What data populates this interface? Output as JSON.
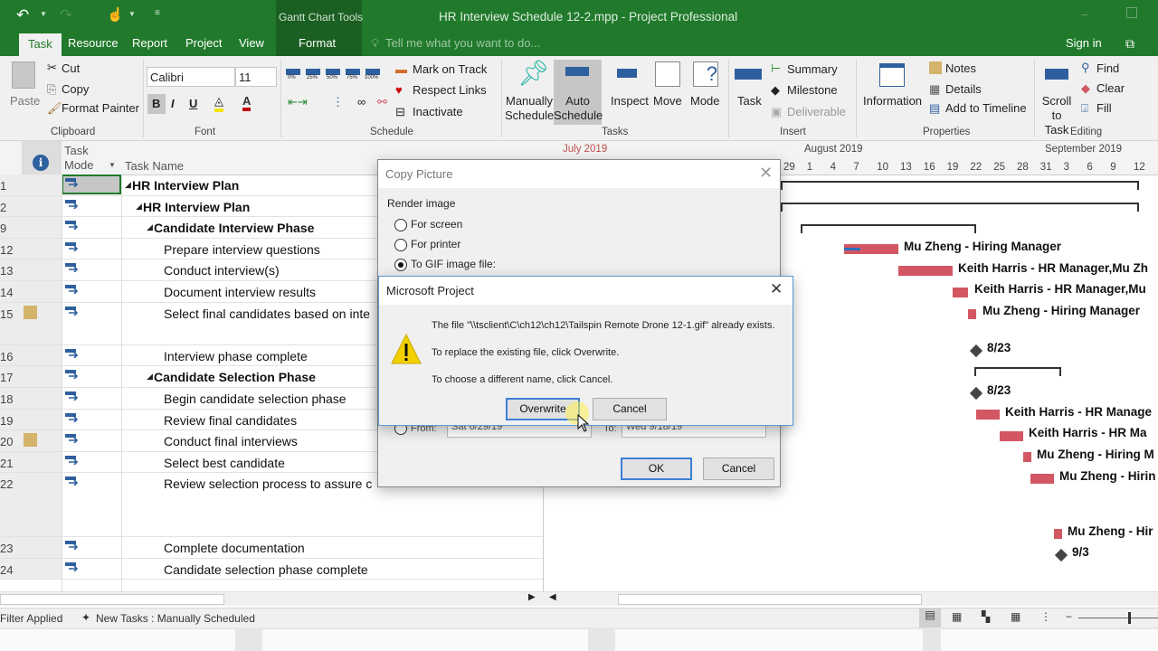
{
  "window": {
    "title": "HR Interview Schedule 12-2.mpp - Project Professional",
    "context_tab_group": "Gantt Chart Tools",
    "sign_in": "Sign in"
  },
  "tabs": [
    {
      "label": "Task",
      "active": true
    },
    {
      "label": "Resource"
    },
    {
      "label": "Report"
    },
    {
      "label": "Project"
    },
    {
      "label": "View"
    },
    {
      "label": "Format"
    }
  ],
  "tell_me": {
    "placeholder": "Tell me what you want to do..."
  },
  "ribbon": {
    "clipboard": {
      "paste": "Paste",
      "cut": "Cut",
      "copy": "Copy",
      "format_painter": "Format Painter",
      "group": "Clipboard"
    },
    "font": {
      "family": "Calibri",
      "size": "11",
      "bold": "B",
      "italic": "I",
      "underline": "U",
      "group": "Font"
    },
    "schedule": {
      "percent": [
        "0%",
        "25%",
        "50%",
        "75%",
        "100%"
      ],
      "mark_on_track": "Mark on Track",
      "respect_links": "Respect Links",
      "inactivate": "Inactivate",
      "group": "Schedule"
    },
    "tasks": {
      "manually": "Manually Schedule",
      "auto": "Auto Schedule",
      "inspect": "Inspect",
      "move": "Move",
      "mode": "Mode",
      "group": "Tasks"
    },
    "insert": {
      "task": "Task",
      "summary": "Summary",
      "milestone": "Milestone",
      "deliverable": "Deliverable",
      "group": "Insert"
    },
    "properties": {
      "information": "Information",
      "notes": "Notes",
      "details": "Details",
      "add_to_timeline": "Add to Timeline",
      "group": "Properties"
    },
    "editing": {
      "scroll_to_task": "Scroll to Task",
      "find": "Find",
      "clear": "Clear",
      "fill": "Fill",
      "group": "Editing"
    }
  },
  "table": {
    "headers": {
      "task_mode": "Task Mode",
      "task_name": "Task Name"
    },
    "rows": [
      {
        "id": "1",
        "name": "HR Interview Plan",
        "level": 0,
        "summary": true
      },
      {
        "id": "2",
        "name": "HR Interview Plan",
        "level": 1,
        "summary": true
      },
      {
        "id": "9",
        "name": "Candidate Interview Phase",
        "level": 2,
        "summary": true
      },
      {
        "id": "12",
        "name": "Prepare interview questions",
        "level": 3
      },
      {
        "id": "13",
        "name": "Conduct interview(s)",
        "level": 3
      },
      {
        "id": "14",
        "name": "Document interview results",
        "level": 3
      },
      {
        "id": "15",
        "name": "Select final candidates based on inte",
        "level": 3,
        "note": true
      },
      {
        "id": "16",
        "name": "Interview phase complete",
        "level": 3
      },
      {
        "id": "17",
        "name": "Candidate Selection Phase",
        "level": 2,
        "summary": true
      },
      {
        "id": "18",
        "name": "Begin candidate selection phase",
        "level": 3
      },
      {
        "id": "19",
        "name": "Review final candidates",
        "level": 3
      },
      {
        "id": "20",
        "name": "Conduct final interviews",
        "level": 3,
        "note": true
      },
      {
        "id": "21",
        "name": "Select best candidate",
        "level": 3
      },
      {
        "id": "22",
        "name": "Review selection process to assure c",
        "level": 3
      },
      {
        "id": "23",
        "name": "Complete documentation",
        "level": 3
      },
      {
        "id": "24",
        "name": "Candidate selection phase complete",
        "level": 3
      }
    ]
  },
  "timescale": {
    "months": [
      "July 2019",
      "August 2019",
      "September 2019"
    ],
    "days": [
      "29",
      "1",
      "4",
      "7",
      "10",
      "13",
      "16",
      "19",
      "22",
      "25",
      "28",
      "31",
      "3",
      "6",
      "9",
      "12"
    ]
  },
  "gantt_labels": [
    "Mu Zheng - Hiring Manager",
    "Keith Harris - HR Manager,Mu Zh",
    "Keith Harris - HR Manager,Mu",
    "Mu Zheng - Hiring Manager",
    "8/23",
    "8/23",
    "Keith Harris - HR Manage",
    "Keith Harris - HR Ma",
    "Mu Zheng - Hiring M",
    "Mu Zheng - Hirin",
    "Mu Zheng - Hir",
    "9/3"
  ],
  "copy_picture": {
    "title": "Copy Picture",
    "render_image": "Render image",
    "for_screen": "For screen",
    "for_printer": "For printer",
    "to_gif": "To GIF image file:",
    "selected": "To GIF image file:",
    "from_label": "From:",
    "from_value": "Sat 6/29/19",
    "to_label": "To:",
    "to_value": "Wed 9/18/19",
    "ok": "OK",
    "cancel": "Cancel"
  },
  "alert": {
    "title": "Microsoft Project",
    "line1": "The file \"\\\\tsclient\\C\\ch12\\ch12\\Tailspin Remote Drone 12-1.gif\" already exists.",
    "line2": "To replace the existing file, click Overwrite.",
    "line3": "To choose a different name, click Cancel.",
    "overwrite": "Overwrite",
    "cancel": "Cancel"
  },
  "status": {
    "filter": "Filter Applied",
    "new_tasks": "New Tasks : Manually Scheduled"
  },
  "colors": {
    "brand": "#217a2c",
    "bar": "#d35763",
    "accent": "#3c7fd6"
  }
}
